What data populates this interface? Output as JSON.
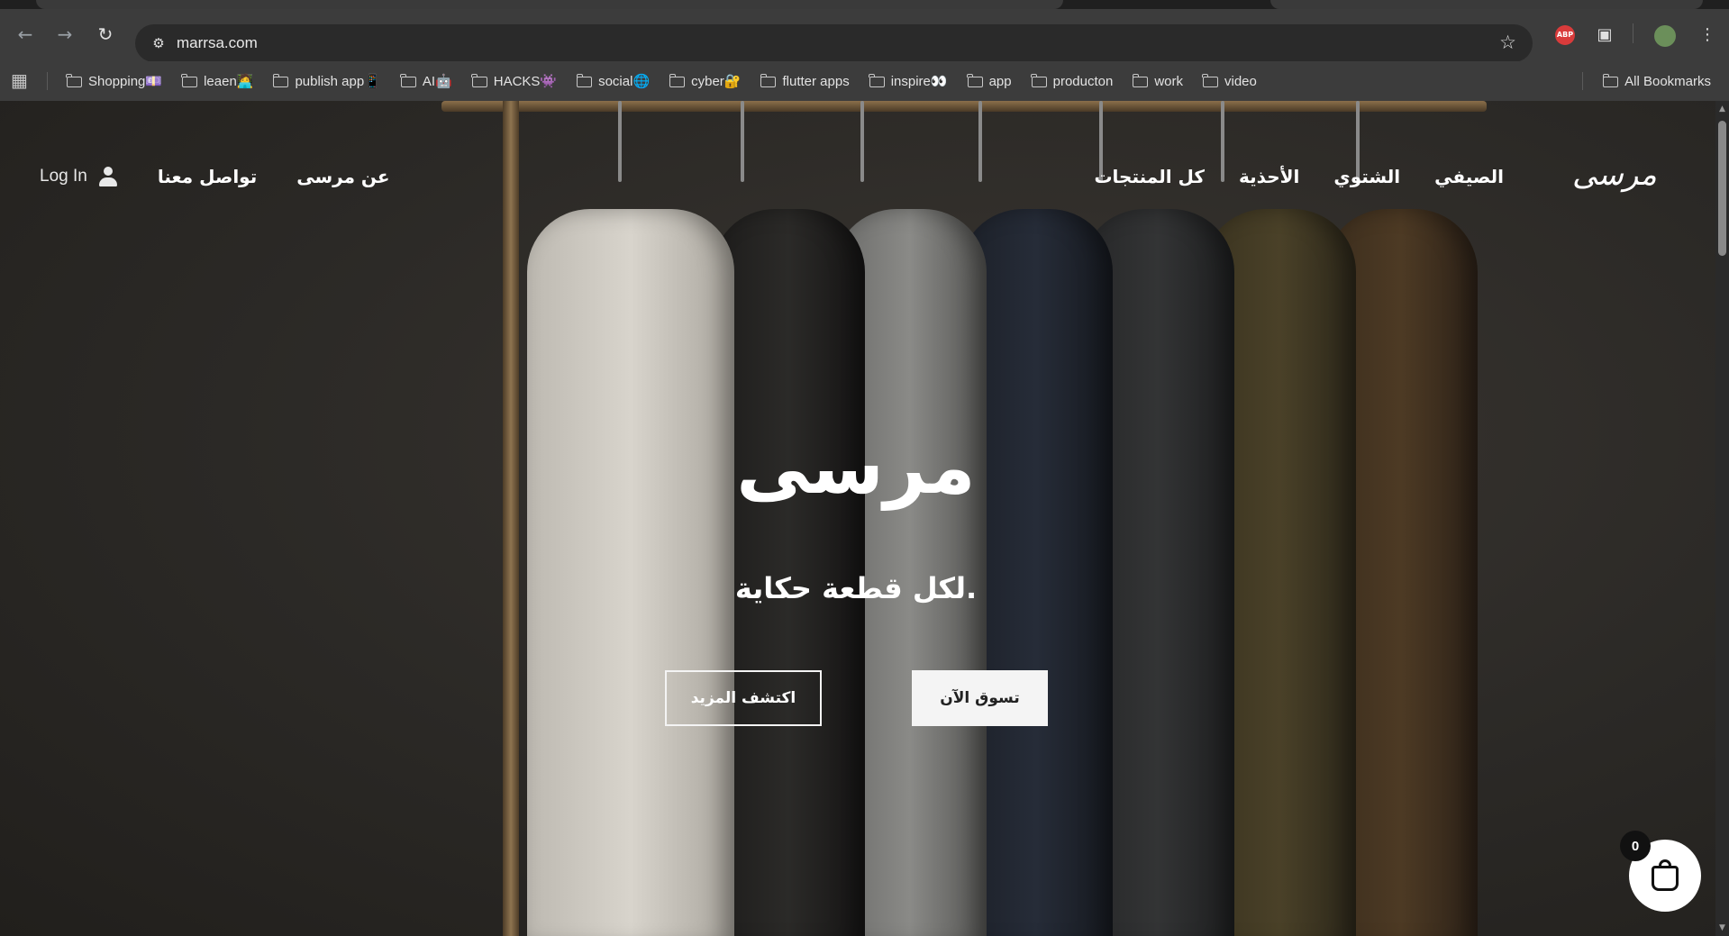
{
  "browser": {
    "url": "marrsa.com",
    "bookmarks": [
      {
        "label": "Shopping💷"
      },
      {
        "label": "leaen🧑‍💻"
      },
      {
        "label": "publish app📱"
      },
      {
        "label": "AI🤖"
      },
      {
        "label": "HACKS👾"
      },
      {
        "label": "social🌐"
      },
      {
        "label": "cyber🔐"
      },
      {
        "label": "flutter apps"
      },
      {
        "label": "inspire👀"
      },
      {
        "label": "app"
      },
      {
        "label": "producton"
      },
      {
        "label": "work"
      },
      {
        "label": "video"
      }
    ],
    "all_bookmarks": "All Bookmarks",
    "extension_abp": "ABP"
  },
  "site": {
    "logo": "مرسى",
    "nav": [
      {
        "label": "الصيفي"
      },
      {
        "label": "الشتوي"
      },
      {
        "label": "الأحذية"
      },
      {
        "label": "كل المنتجات"
      }
    ],
    "about": "عن مرسى",
    "contact": "تواصل معنا",
    "login": "Log In"
  },
  "hero": {
    "title": "مرسى",
    "tagline": "لكل قطعة حكاية.",
    "shop_now": "تسوق الآن",
    "discover_more": "اكتشف المزيد"
  },
  "cart": {
    "count": "0"
  }
}
